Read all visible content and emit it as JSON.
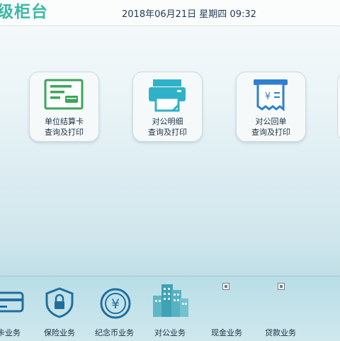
{
  "header": {
    "title": "级柜台",
    "datetime": "2018年06月21日 星期四 09:32"
  },
  "tiles": [
    {
      "line1": "单位结算卡",
      "line2": "查询及打印",
      "icon": "settlement-card-icon"
    },
    {
      "line1": "对公明细",
      "line2": "查询及打印",
      "icon": "printer-icon"
    },
    {
      "line1": "对公回单",
      "line2": "查询及打印",
      "icon": "receipt-printer-icon"
    }
  ],
  "bottom_nav": [
    {
      "label": "卡业务",
      "icon": "card-icon"
    },
    {
      "label": "保险业务",
      "icon": "shield-lock-icon"
    },
    {
      "label": "纪念币业务",
      "icon": "yuan-coin-icon"
    },
    {
      "label": "对公业务",
      "icon": "buildings-icon"
    },
    {
      "label": "现金业务",
      "icon": "broken-image-icon"
    },
    {
      "label": "贷款业务",
      "icon": "broken-image-icon"
    }
  ],
  "colors": {
    "brand_green": "#3cb8a7",
    "icon_green": "#3aa65a",
    "icon_teal": "#2fb2c8",
    "icon_blue": "#2e7fd0",
    "nav_icon_blue": "#1f6f9e"
  }
}
